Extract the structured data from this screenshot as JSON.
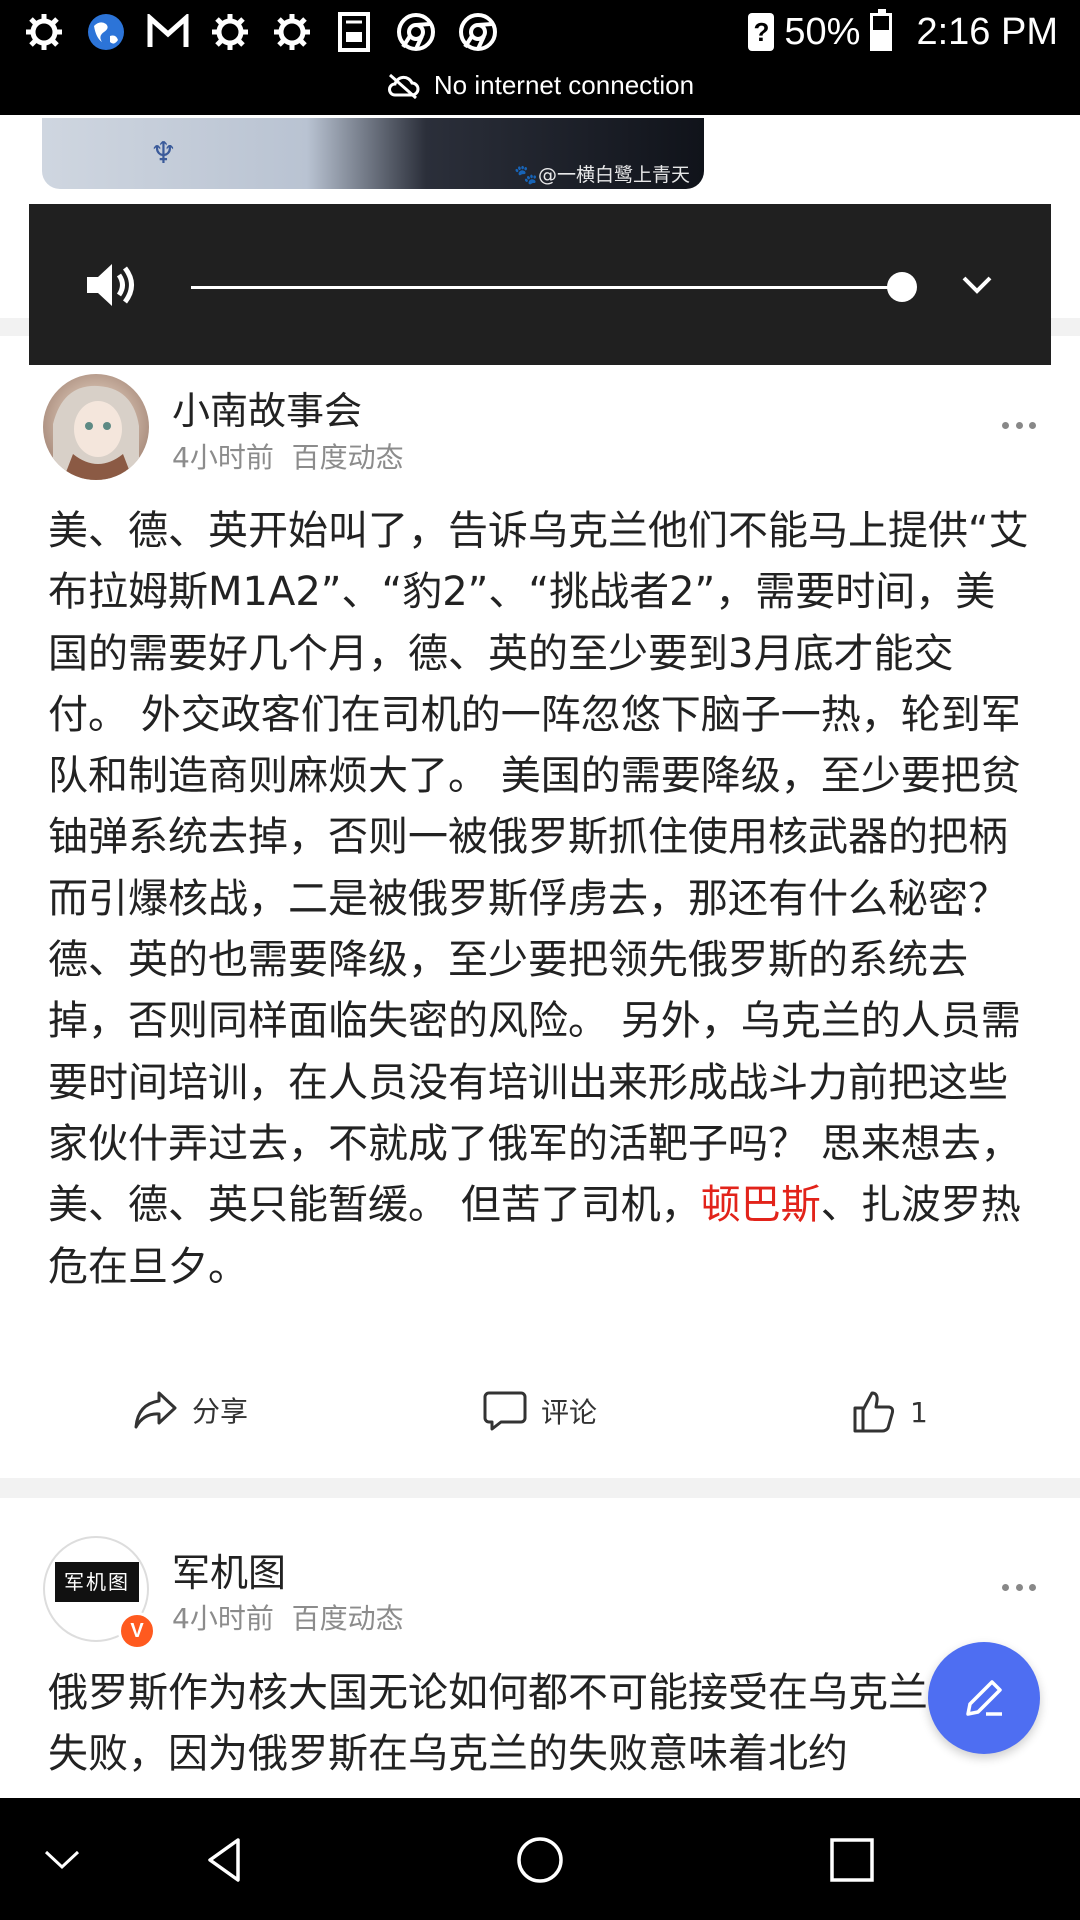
{
  "status_bar": {
    "icons": [
      "settings-gear-icon",
      "globe-icon",
      "gmail-icon",
      "settings-gear-icon",
      "settings-gear-icon",
      "dictionary-icon",
      "chrome-icon",
      "chrome-icon"
    ],
    "unknown_badge": "?",
    "battery": "50%",
    "time": "2:16 PM",
    "connection": "No internet connection"
  },
  "image_strip": {
    "watermark": "🐾@一横白鹭上青天"
  },
  "media_control": {
    "volume_level": 1.0
  },
  "posts": [
    {
      "author": "小南故事会",
      "time": "4小时前",
      "source": "百度动态",
      "content_before": "美、德、英开始叫了，告诉乌克兰他们不能马上提供“艾布拉姆斯M1A2”、“豹2”、“挑战者2”，需要时间，美国的需要好几个月，德、英的至少要到3月底才能交付。 外交政客们在司机的一阵忽悠下脑子一热，轮到军队和制造商则麻烦大了。 美国的需要降级，至少要把贫铀弹系统去掉，否则一被俄罗斯抓住使用核武器的把柄而引爆核战，二是被俄罗斯俘虏去，那还有什么秘密？ 德、英的也需要降级，至少要把领先俄罗斯的系统去掉，否则同样面临失密的风险。 另外，乌克兰的人员需要时间培训，在人员没有培训出来形成战斗力前把这些家伙什弄过去，不就成了俄军的活靶子吗？ 思来想去，美、德、英只能暂缓。 但苦了司机，",
      "content_highlight": "顿巴斯",
      "content_after": "、扎波罗热危在旦夕。",
      "share_label": "分享",
      "comment_label": "评论",
      "like_count": "1"
    },
    {
      "author": "军机图",
      "avatar_text": "军机图",
      "verified_badge": "V",
      "time": "4小时前",
      "source": "百度动态",
      "content": "俄罗斯作为核大国无论如何都不可能接受在乌克兰战场失败，因为俄罗斯在乌克兰的失败意味着北约"
    }
  ],
  "colors": {
    "highlight": "#e2231a",
    "fab": "#4e6ef2",
    "badge": "#ff5a1f"
  }
}
